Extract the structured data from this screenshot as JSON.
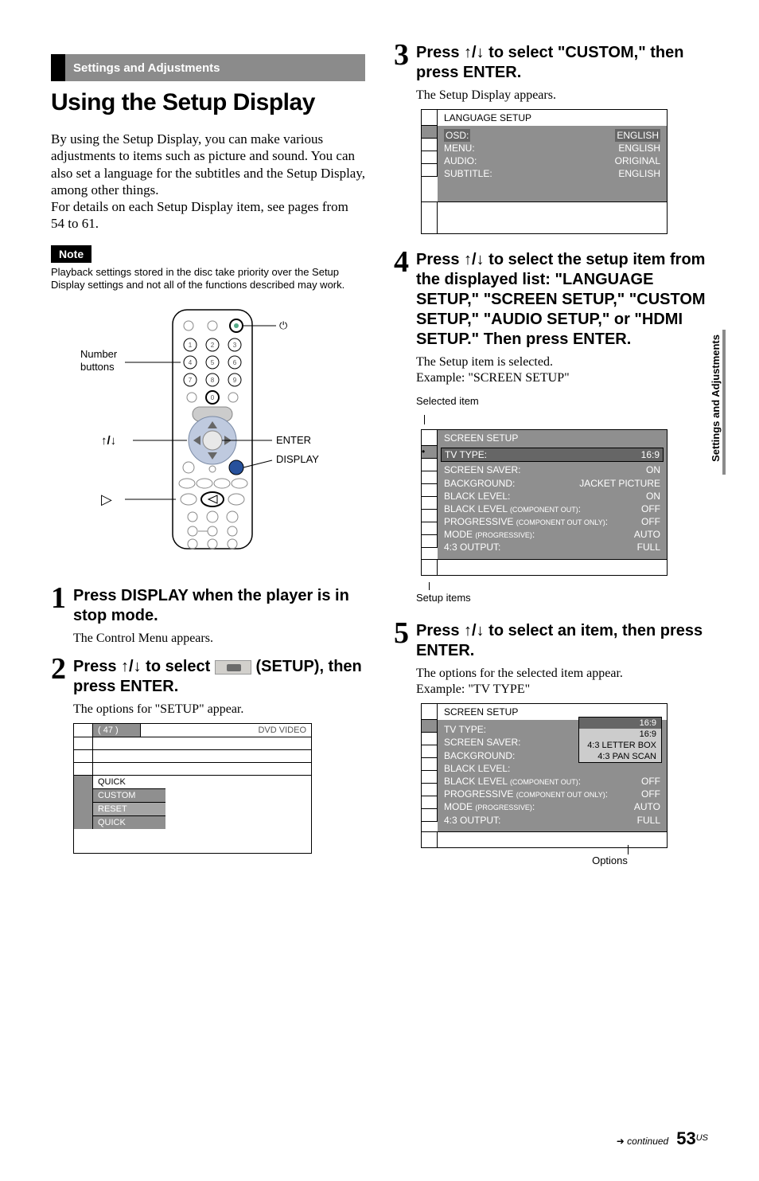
{
  "section_header": "Settings and Adjustments",
  "main_title": "Using the Setup Display",
  "intro_para": "By using the Setup Display, you can make various adjustments to items such as picture and sound. You can also set a language for the subtitles and the Setup Display, among other things.\nFor details on each Setup Display item, see pages from 54 to 61.",
  "note_label": "Note",
  "note_text": "Playback settings stored in the disc take priority over the Setup Display settings and not all of the functions described may work.",
  "remote_labels": {
    "number_buttons": "Number\nbuttons",
    "power": "",
    "arrows": "↑/↓",
    "enter": "ENTER",
    "display": "DISPLAY",
    "play": "▷"
  },
  "steps": {
    "s1": {
      "num": "1",
      "head": "Press DISPLAY when the player is in stop mode.",
      "desc": "The Control Menu appears."
    },
    "s2": {
      "num": "2",
      "head_pre": "Press ↑/↓ to select ",
      "head_post": " (SETUP), then press ENTER.",
      "desc": "The options for \"SETUP\" appear.",
      "osd": {
        "count": "( 47 )",
        "mode": "DVD VIDEO",
        "items": [
          "QUICK",
          "CUSTOM",
          "RESET",
          "QUICK"
        ]
      }
    },
    "s3": {
      "num": "3",
      "head": "Press ↑/↓ to select \"CUSTOM,\" then press ENTER.",
      "desc": "The Setup Display appears.",
      "osd": {
        "heading": "LANGUAGE SETUP",
        "rows": [
          {
            "l": "OSD:",
            "r": "ENGLISH"
          },
          {
            "l": "MENU:",
            "r": "ENGLISH"
          },
          {
            "l": "AUDIO:",
            "r": "ORIGINAL"
          },
          {
            "l": "SUBTITLE:",
            "r": "ENGLISH"
          }
        ]
      }
    },
    "s4": {
      "num": "4",
      "head": "Press ↑/↓ to select the setup item from the displayed list: \"LANGUAGE SETUP,\" \"SCREEN SETUP,\" \"CUSTOM SETUP,\" \"AUDIO SETUP,\" or \"HDMI SETUP.\" Then press ENTER.",
      "desc1": "The Setup item is selected.",
      "desc2": "Example: \"SCREEN SETUP\"",
      "sel_label": "Selected item",
      "osd": {
        "heading": "SCREEN SETUP",
        "highlight": {
          "l": "TV TYPE:",
          "r": "16:9"
        },
        "rows": [
          {
            "l": "SCREEN SAVER:",
            "r": "ON"
          },
          {
            "l": "BACKGROUND:",
            "r": "JACKET PICTURE"
          },
          {
            "l": "BLACK LEVEL:",
            "r": "ON"
          },
          {
            "l": "BLACK LEVEL (COMPONENT OUT):",
            "r": "OFF"
          },
          {
            "l": "PROGRESSIVE (COMPONENT OUT ONLY):",
            "r": "OFF"
          },
          {
            "l": "MODE (PROGRESSIVE):",
            "r": "AUTO"
          },
          {
            "l": "4:3 OUTPUT:",
            "r": "FULL"
          }
        ]
      },
      "setup_items_label": "Setup items"
    },
    "s5": {
      "num": "5",
      "head": "Press ↑/↓ to select an item, then press ENTER.",
      "desc1": "The options for the selected item appear.",
      "desc2": "Example: \"TV TYPE\"",
      "osd": {
        "heading": "SCREEN SETUP",
        "rows": [
          {
            "l": "TV TYPE:",
            "r": "16:9"
          },
          {
            "l": "SCREEN SAVER:",
            "r": ""
          },
          {
            "l": "BACKGROUND:",
            "r": ""
          },
          {
            "l": "BLACK LEVEL:",
            "r": ""
          },
          {
            "l": "BLACK LEVEL (COMPONENT OUT):",
            "r": "OFF"
          },
          {
            "l": "PROGRESSIVE (COMPONENT OUT ONLY):",
            "r": "OFF"
          },
          {
            "l": "MODE (PROGRESSIVE):",
            "r": "AUTO"
          },
          {
            "l": "4:3 OUTPUT:",
            "r": "FULL"
          }
        ],
        "popup": [
          "16:9",
          "16:9",
          "4:3 LETTER BOX",
          "4:3 PAN SCAN"
        ]
      },
      "options_label": "Options"
    }
  },
  "side_tab": "Settings and Adjustments",
  "footer": {
    "continued": "continued",
    "page": "53",
    "us": "US",
    "arrow": "➜"
  }
}
